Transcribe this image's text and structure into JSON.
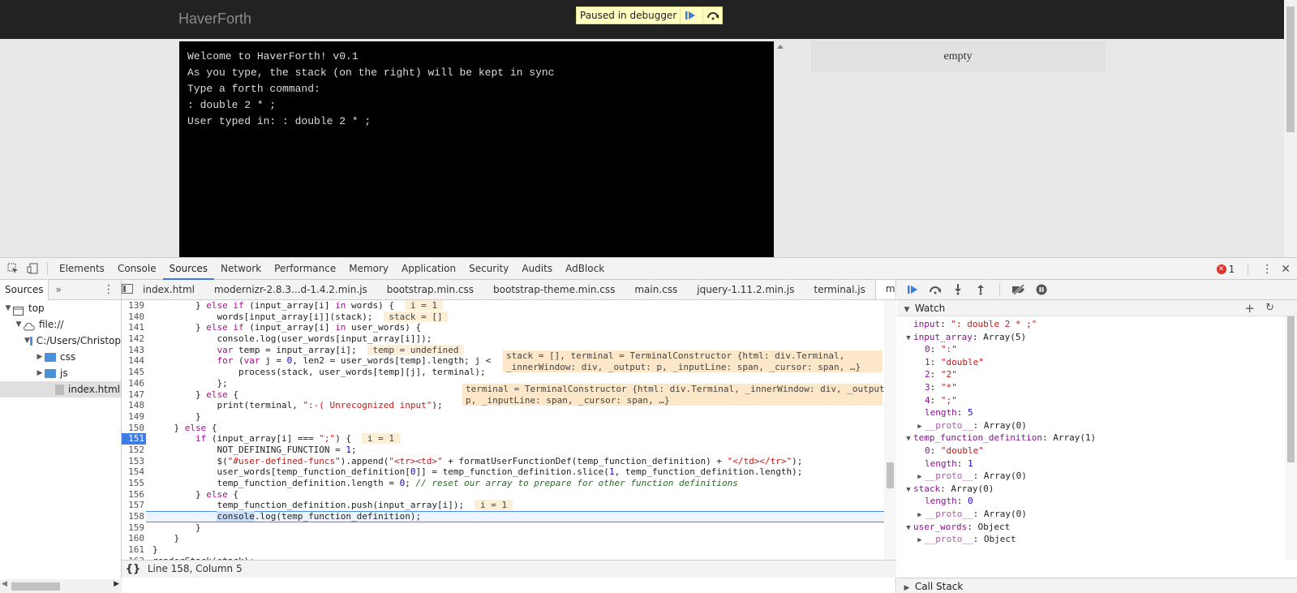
{
  "page": {
    "brand": "HaverForth",
    "paused_label": "Paused in debugger",
    "terminal_lines": [
      "Welcome to HaverForth! v0.1",
      "As you type, the stack (on the right) will be kept in sync",
      "Type a forth command:",
      ": double 2 * ;",
      "User typed in: : double 2 * ;"
    ],
    "stack_text": "empty"
  },
  "devtools": {
    "tabs": [
      "Elements",
      "Console",
      "Sources",
      "Network",
      "Performance",
      "Memory",
      "Application",
      "Security",
      "Audits",
      "AdBlock"
    ],
    "active_tab": "Sources",
    "error_count": "1",
    "navigator": {
      "tab": "Sources",
      "tree": [
        {
          "label": "top",
          "depth": 0,
          "arrow": "▼",
          "icon": "window"
        },
        {
          "label": "file://",
          "depth": 1,
          "arrow": "▼",
          "icon": "cloud"
        },
        {
          "label": "C:/Users/Christop",
          "depth": 2,
          "arrow": "▼",
          "icon": "folder"
        },
        {
          "label": "css",
          "depth": 3,
          "arrow": "▶",
          "icon": "folder"
        },
        {
          "label": "js",
          "depth": 3,
          "arrow": "▶",
          "icon": "folder"
        },
        {
          "label": "index.html",
          "depth": 4,
          "arrow": "",
          "icon": "doc"
        }
      ]
    },
    "editor": {
      "files": [
        "index.html",
        "modernizr-2.8.3...d-1.4.2.min.js",
        "bootstrap.min.css",
        "bootstrap-theme.min.css",
        "main.css",
        "jquery-1.11.2.min.js",
        "terminal.js",
        "main.js"
      ],
      "active_file": "main.js",
      "status": "Line 158, Column 5",
      "breakpoint_line": "151",
      "current_line": "158",
      "popups": {
        "stack_terminal": [
          "stack = [], terminal = TerminalConstructor {html: div.Terminal,",
          "_innerWindow: div, _output: p, _inputLine: span, _cursor: span, …}"
        ],
        "terminal": [
          "terminal = TerminalConstructor {html: div.Terminal, _innerWindow: div, _output:",
          "p, _inputLine: span, _cursor: span, …}"
        ]
      }
    },
    "watch": {
      "title": "Watch",
      "rows": [
        {
          "indent": 0,
          "arrow": "",
          "key": "input",
          "sep": ": ",
          "val": "\": double 2 * ;\"",
          "type": "str"
        },
        {
          "indent": 0,
          "arrow": "▼",
          "key": "input_array",
          "sep": ": ",
          "val": "Array(5)",
          "type": "plain"
        },
        {
          "indent": 1,
          "arrow": "",
          "key": "0",
          "sep": ": ",
          "val": "\":\"",
          "type": "str"
        },
        {
          "indent": 1,
          "arrow": "",
          "key": "1",
          "sep": ": ",
          "val": "\"double\"",
          "type": "str"
        },
        {
          "indent": 1,
          "arrow": "",
          "key": "2",
          "sep": ": ",
          "val": "\"2\"",
          "type": "str"
        },
        {
          "indent": 1,
          "arrow": "",
          "key": "3",
          "sep": ": ",
          "val": "\"*\"",
          "type": "str"
        },
        {
          "indent": 1,
          "arrow": "",
          "key": "4",
          "sep": ": ",
          "val": "\";\"",
          "type": "str"
        },
        {
          "indent": 1,
          "arrow": "",
          "key": "length",
          "sep": ": ",
          "val": "5",
          "type": "num"
        },
        {
          "indent": 1,
          "arrow": "▶",
          "key": "__proto__",
          "sep": ": ",
          "val": "Array(0)",
          "type": "proto"
        },
        {
          "indent": 0,
          "arrow": "▼",
          "key": "temp_function_definition",
          "sep": ": ",
          "val": "Array(1)",
          "type": "plain"
        },
        {
          "indent": 1,
          "arrow": "",
          "key": "0",
          "sep": ": ",
          "val": "\"double\"",
          "type": "str"
        },
        {
          "indent": 1,
          "arrow": "",
          "key": "length",
          "sep": ": ",
          "val": "1",
          "type": "num"
        },
        {
          "indent": 1,
          "arrow": "▶",
          "key": "__proto__",
          "sep": ": ",
          "val": "Array(0)",
          "type": "proto"
        },
        {
          "indent": 0,
          "arrow": "▼",
          "key": "stack",
          "sep": ": ",
          "val": "Array(0)",
          "type": "plain"
        },
        {
          "indent": 1,
          "arrow": "",
          "key": "length",
          "sep": ": ",
          "val": "0",
          "type": "num"
        },
        {
          "indent": 1,
          "arrow": "▶",
          "key": "__proto__",
          "sep": ": ",
          "val": "Array(0)",
          "type": "proto"
        },
        {
          "indent": 0,
          "arrow": "▼",
          "key": "user_words",
          "sep": ": ",
          "val": "Object",
          "type": "plain"
        },
        {
          "indent": 1,
          "arrow": "▶",
          "key": "__proto__",
          "sep": ": ",
          "val": "Object",
          "type": "proto"
        }
      ]
    },
    "call_stack_title": "Call Stack"
  }
}
